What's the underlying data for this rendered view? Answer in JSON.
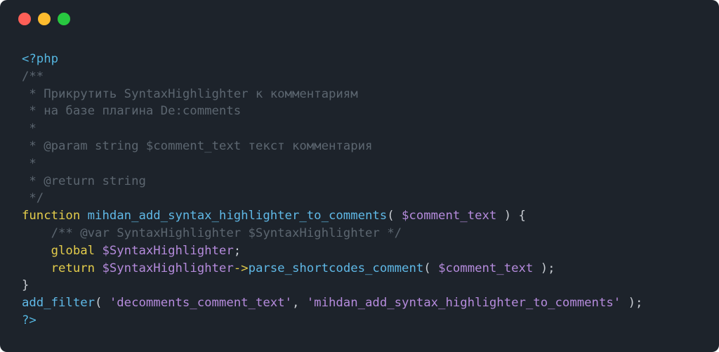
{
  "window": {
    "buttons": [
      {
        "name": "close",
        "color": "#fe5f57"
      },
      {
        "name": "minimize",
        "color": "#febc2e"
      },
      {
        "name": "zoom",
        "color": "#28c840"
      }
    ],
    "background": "#1d232b"
  },
  "code": {
    "lines": [
      [
        {
          "t": "tag",
          "v": "<?php"
        }
      ],
      [
        {
          "t": "comment",
          "v": "/**"
        }
      ],
      [
        {
          "t": "comment",
          "v": " * Прикрутить SyntaxHighlighter к комментариям"
        }
      ],
      [
        {
          "t": "comment",
          "v": " * на базе плагина De:comments"
        }
      ],
      [
        {
          "t": "comment",
          "v": " *"
        }
      ],
      [
        {
          "t": "comment",
          "v": " * @param string $comment_text текст комментария"
        }
      ],
      [
        {
          "t": "comment",
          "v": " *"
        }
      ],
      [
        {
          "t": "comment",
          "v": " * @return string"
        }
      ],
      [
        {
          "t": "comment",
          "v": " */"
        }
      ],
      [
        {
          "t": "keyword",
          "v": "function"
        },
        {
          "t": "default",
          "v": " "
        },
        {
          "t": "func",
          "v": "mihdan_add_syntax_highlighter_to_comments"
        },
        {
          "t": "default",
          "v": "( "
        },
        {
          "t": "var",
          "v": "$comment_text"
        },
        {
          "t": "default",
          "v": " ) {"
        }
      ],
      [
        {
          "t": "comment",
          "v": "    /** @var SyntaxHighlighter $SyntaxHighlighter */"
        }
      ],
      [
        {
          "t": "default",
          "v": "    "
        },
        {
          "t": "keyword",
          "v": "global"
        },
        {
          "t": "default",
          "v": " "
        },
        {
          "t": "var",
          "v": "$SyntaxHighlighter"
        },
        {
          "t": "default",
          "v": ";"
        }
      ],
      [
        {
          "t": "default",
          "v": "    "
        },
        {
          "t": "keyword",
          "v": "return"
        },
        {
          "t": "default",
          "v": " "
        },
        {
          "t": "var",
          "v": "$SyntaxHighlighter"
        },
        {
          "t": "arrow",
          "v": "->"
        },
        {
          "t": "func",
          "v": "parse_shortcodes_comment"
        },
        {
          "t": "default",
          "v": "( "
        },
        {
          "t": "var",
          "v": "$comment_text"
        },
        {
          "t": "default",
          "v": " );"
        }
      ],
      [
        {
          "t": "default",
          "v": "}"
        }
      ],
      [
        {
          "t": "func",
          "v": "add_filter"
        },
        {
          "t": "default",
          "v": "( "
        },
        {
          "t": "string",
          "v": "'decomments_comment_text'"
        },
        {
          "t": "default",
          "v": ", "
        },
        {
          "t": "string",
          "v": "'mihdan_add_syntax_highlighter_to_comments'"
        },
        {
          "t": "default",
          "v": " );"
        }
      ],
      [
        {
          "t": "tag",
          "v": "?>"
        }
      ]
    ]
  }
}
